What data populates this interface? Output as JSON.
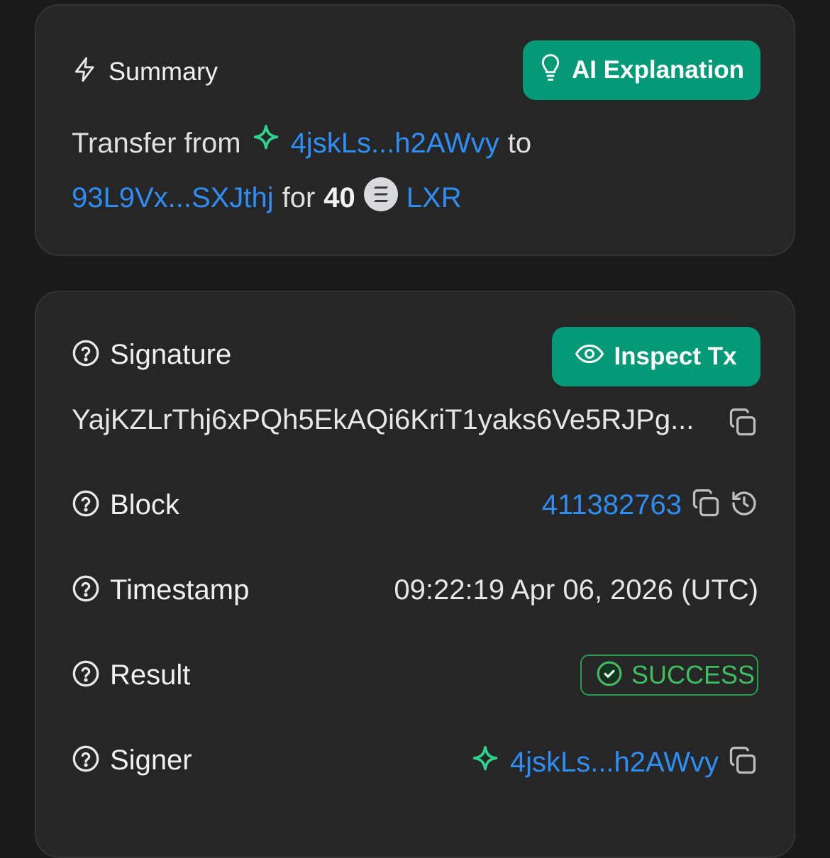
{
  "summary": {
    "heading": "Summary",
    "ai_button": "AI Explanation",
    "line1": {
      "prefix": "Transfer from",
      "from_addr": "4jskLs...h2AWvy",
      "to_word": "to"
    },
    "line2": {
      "to_addr": "93L9Vx...SXJthj",
      "for_word": "for",
      "amount": "40",
      "token": "LXR"
    }
  },
  "details": {
    "signature": {
      "label": "Signature",
      "inspect_button": "Inspect Tx",
      "value": "YajKZLrThj6xPQh5EkAQi6KriT1yaks6Ve5RJPg..."
    },
    "block": {
      "label": "Block",
      "value": "411382763"
    },
    "timestamp": {
      "label": "Timestamp",
      "value": "09:22:19 Apr 06, 2026 (UTC)"
    },
    "result": {
      "label": "Result",
      "value": "SUCCESS"
    },
    "signer": {
      "label": "Signer",
      "value": "4jskLs...h2AWvy"
    }
  },
  "colors": {
    "accent_green": "#059a77",
    "link_blue": "#2f8ef3",
    "success_green": "#3dbf5e",
    "sparkle_green": "#2fd28a"
  }
}
